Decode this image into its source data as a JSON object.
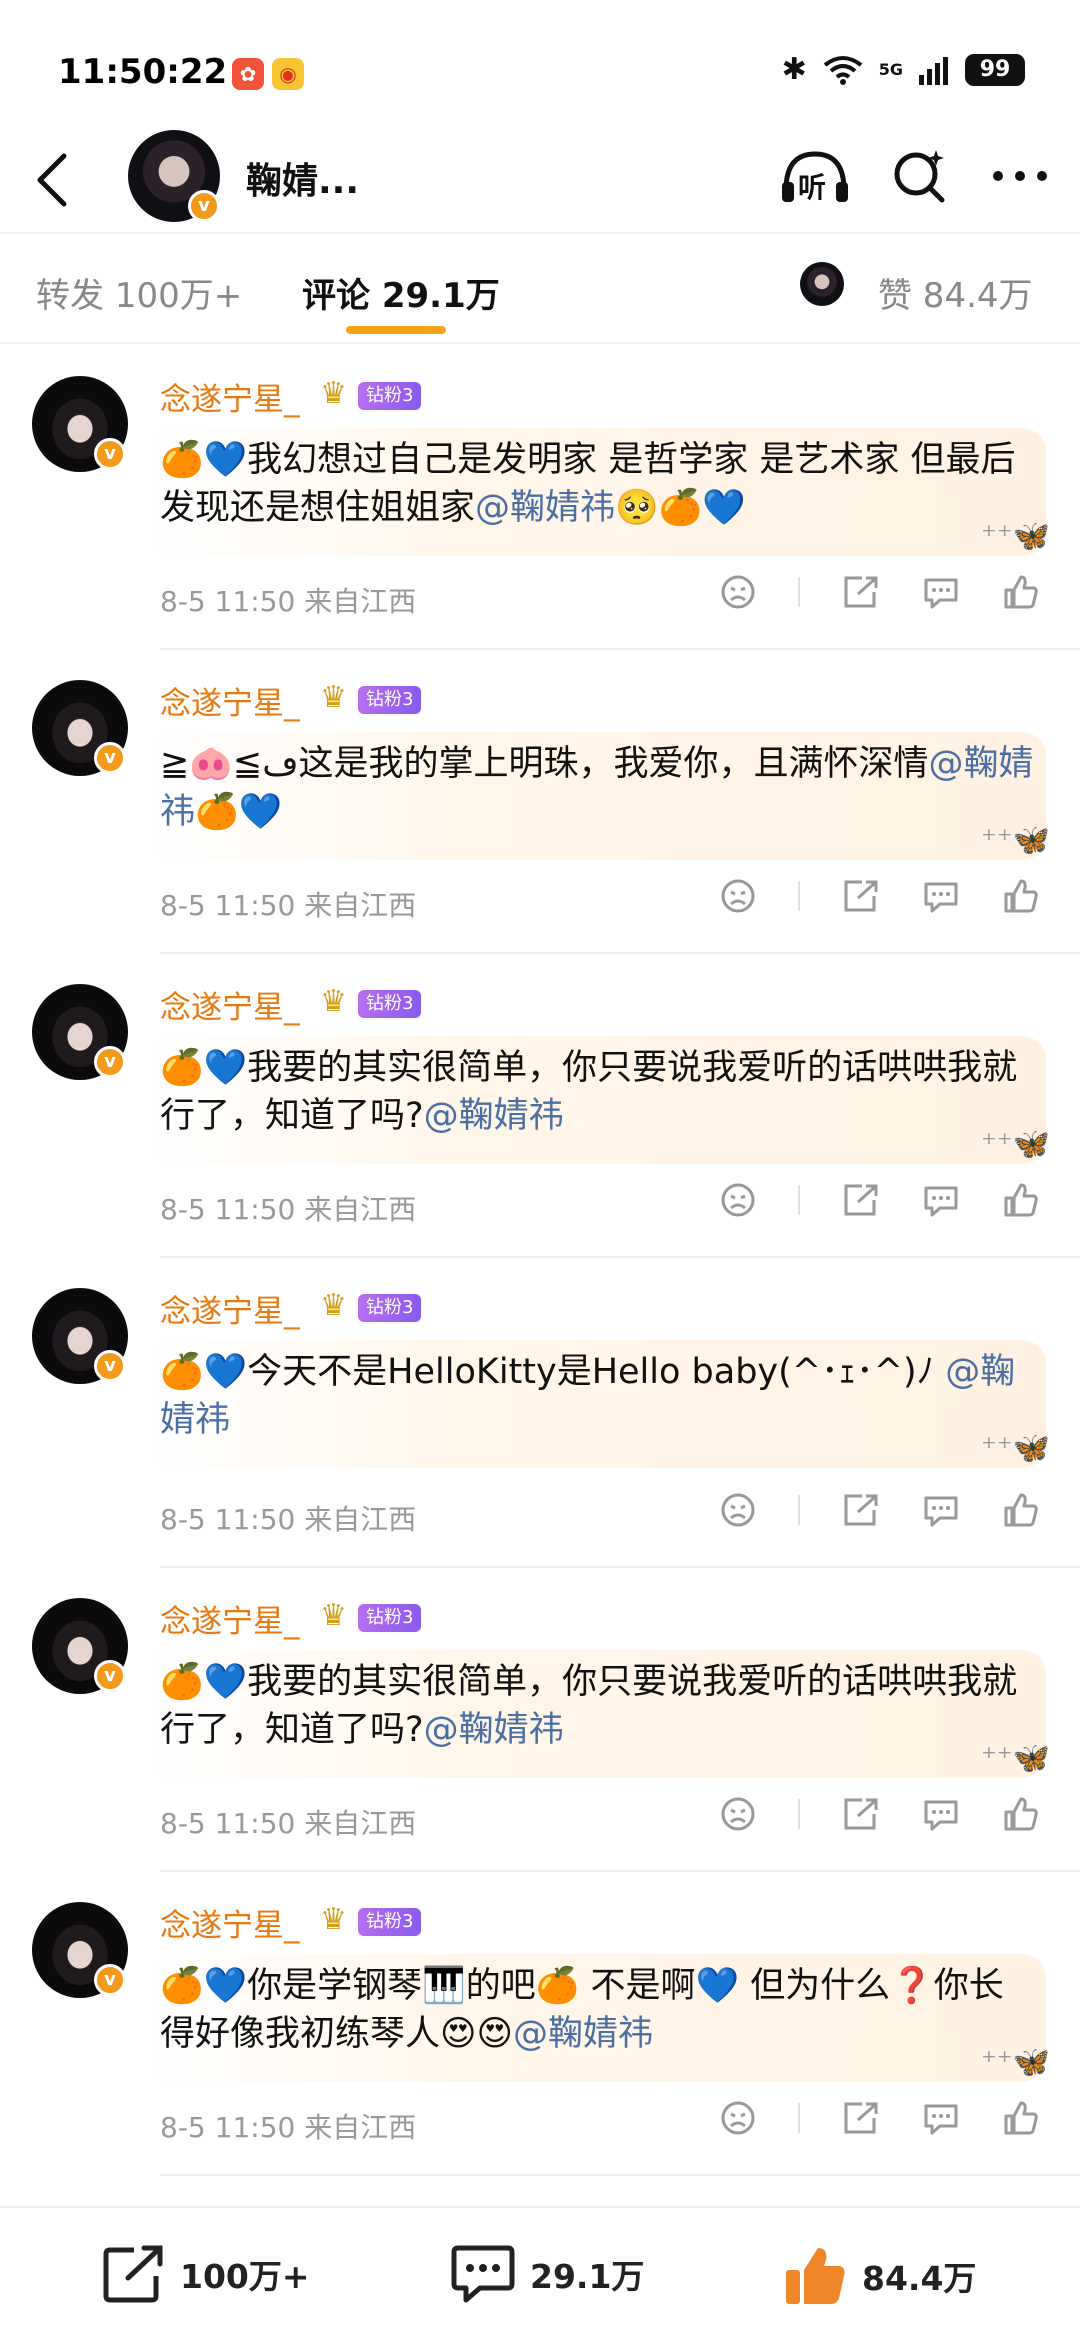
{
  "status_bar": {
    "time": "11:50:22",
    "battery": "99",
    "network": "5G"
  },
  "header": {
    "name": "鞠婧...",
    "listen_label": "听"
  },
  "tabs": {
    "repost": "转发 100万+",
    "comment": "评论 29.1万",
    "like": "赞 84.4万"
  },
  "colors": {
    "accent": "#f5a319",
    "username": "#e8780f",
    "mention": "#4a6fa5",
    "like_icon": "#f0862a"
  },
  "comments": [
    {
      "user": "念遂宁星_",
      "fan_badge": "钻粉3",
      "text_before": "🍊💙我幻想过自己是发明家 是哲学家 是艺术家 但最后发现还是想住姐姐家",
      "mention": "@鞠婧祎",
      "text_after": "🥺🍊💙",
      "meta": "8-5 11:50  来自江西"
    },
    {
      "user": "念遂宁星_",
      "fan_badge": "钻粉3",
      "text_before": "≧🐽≦ڡ这是我的掌上明珠，我爱你，且满怀深情",
      "mention": "@鞠婧祎",
      "text_after": "🍊💙",
      "meta": "8-5 11:50  来自江西"
    },
    {
      "user": "念遂宁星_",
      "fan_badge": "钻粉3",
      "text_before": "🍊💙我要的其实很简单，你只要说我爱听的话哄哄我就行了，知道了吗?",
      "mention": "@鞠婧祎",
      "text_after": "",
      "meta": "8-5 11:50  来自江西"
    },
    {
      "user": "念遂宁星_",
      "fan_badge": "钻粉3",
      "text_before": "🍊💙今天不是HelloKitty是Hello baby(^･ｪ･^)ﾉ ",
      "mention": "@鞠婧祎",
      "text_after": "",
      "meta": "8-5 11:50  来自江西"
    },
    {
      "user": "念遂宁星_",
      "fan_badge": "钻粉3",
      "text_before": "🍊💙我要的其实很简单，你只要说我爱听的话哄哄我就行了，知道了吗?",
      "mention": "@鞠婧祎",
      "text_after": "",
      "meta": "8-5 11:50  来自江西"
    },
    {
      "user": "念遂宁星_",
      "fan_badge": "钻粉3",
      "text_before": "🍊💙你是学钢琴🎹的吧🍊 不是啊💙 但为什么❓你长得好像我初练琴人😍😍",
      "mention": "@鞠婧祎",
      "text_after": "",
      "meta": "8-5 11:50  来自江西"
    }
  ],
  "bottom_bar": {
    "repost_count": "100万+",
    "comment_count": "29.1万",
    "like_count": "84.4万"
  }
}
